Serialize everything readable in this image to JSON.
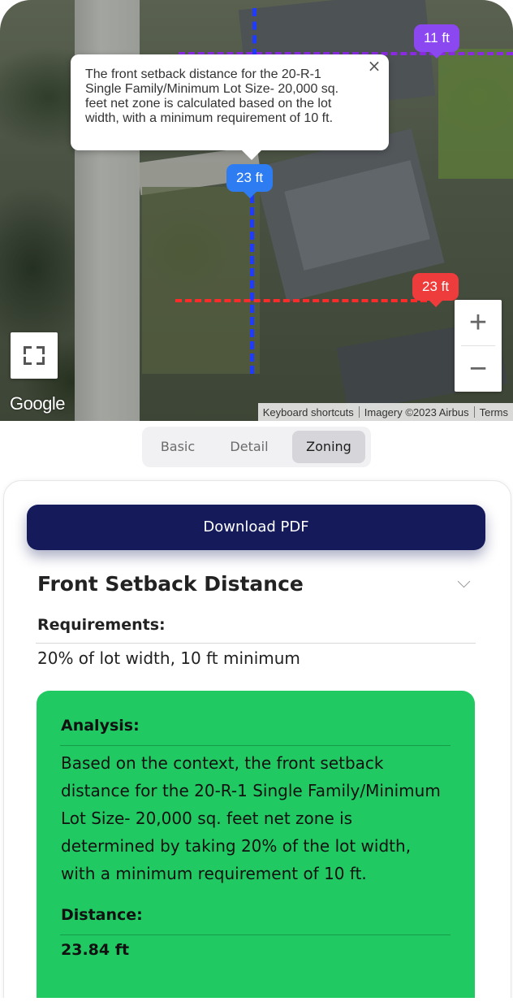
{
  "map": {
    "markers": {
      "purple": "11 ft",
      "blue": "23 ft",
      "red": "23 ft"
    },
    "tooltip": {
      "text": "The front setback distance for the 20-R-1 Single Family/Minimum Lot Size- 20,000 sq. feet net zone is calculated based on the lot width, with a minimum requirement of 10 ft.",
      "close_label": "×"
    },
    "zoom_in_label": "+",
    "zoom_out_label": "−",
    "google_logo": "Google",
    "attribution": {
      "shortcuts": "Keyboard shortcuts",
      "imagery": "Imagery ©2023 Airbus",
      "terms": "Terms"
    }
  },
  "tabs": {
    "basic": "Basic",
    "detail": "Detail",
    "zoning": "Zoning",
    "active": "Zoning"
  },
  "card": {
    "download_label": "Download PDF",
    "section_title": "Front Setback Distance",
    "requirements_label": "Requirements:",
    "requirements_value": "20% of lot width, 10 ft minimum",
    "analysis_label": "Analysis:",
    "analysis_text": "Based on the context, the front setback distance for the 20-R-1 Single Family/Minimum Lot Size- 20,000 sq. feet net zone is determined by taking 20% of the lot width, with a minimum requirement of 10 ft.",
    "distance_label": "Distance:",
    "distance_value": "23.84 ft"
  },
  "colors": {
    "accent_navy": "#141a5a",
    "analysis_green": "#21c962",
    "marker_purple": "#8b47f0",
    "marker_blue": "#2d7cf2",
    "marker_red": "#ee3b3b"
  }
}
